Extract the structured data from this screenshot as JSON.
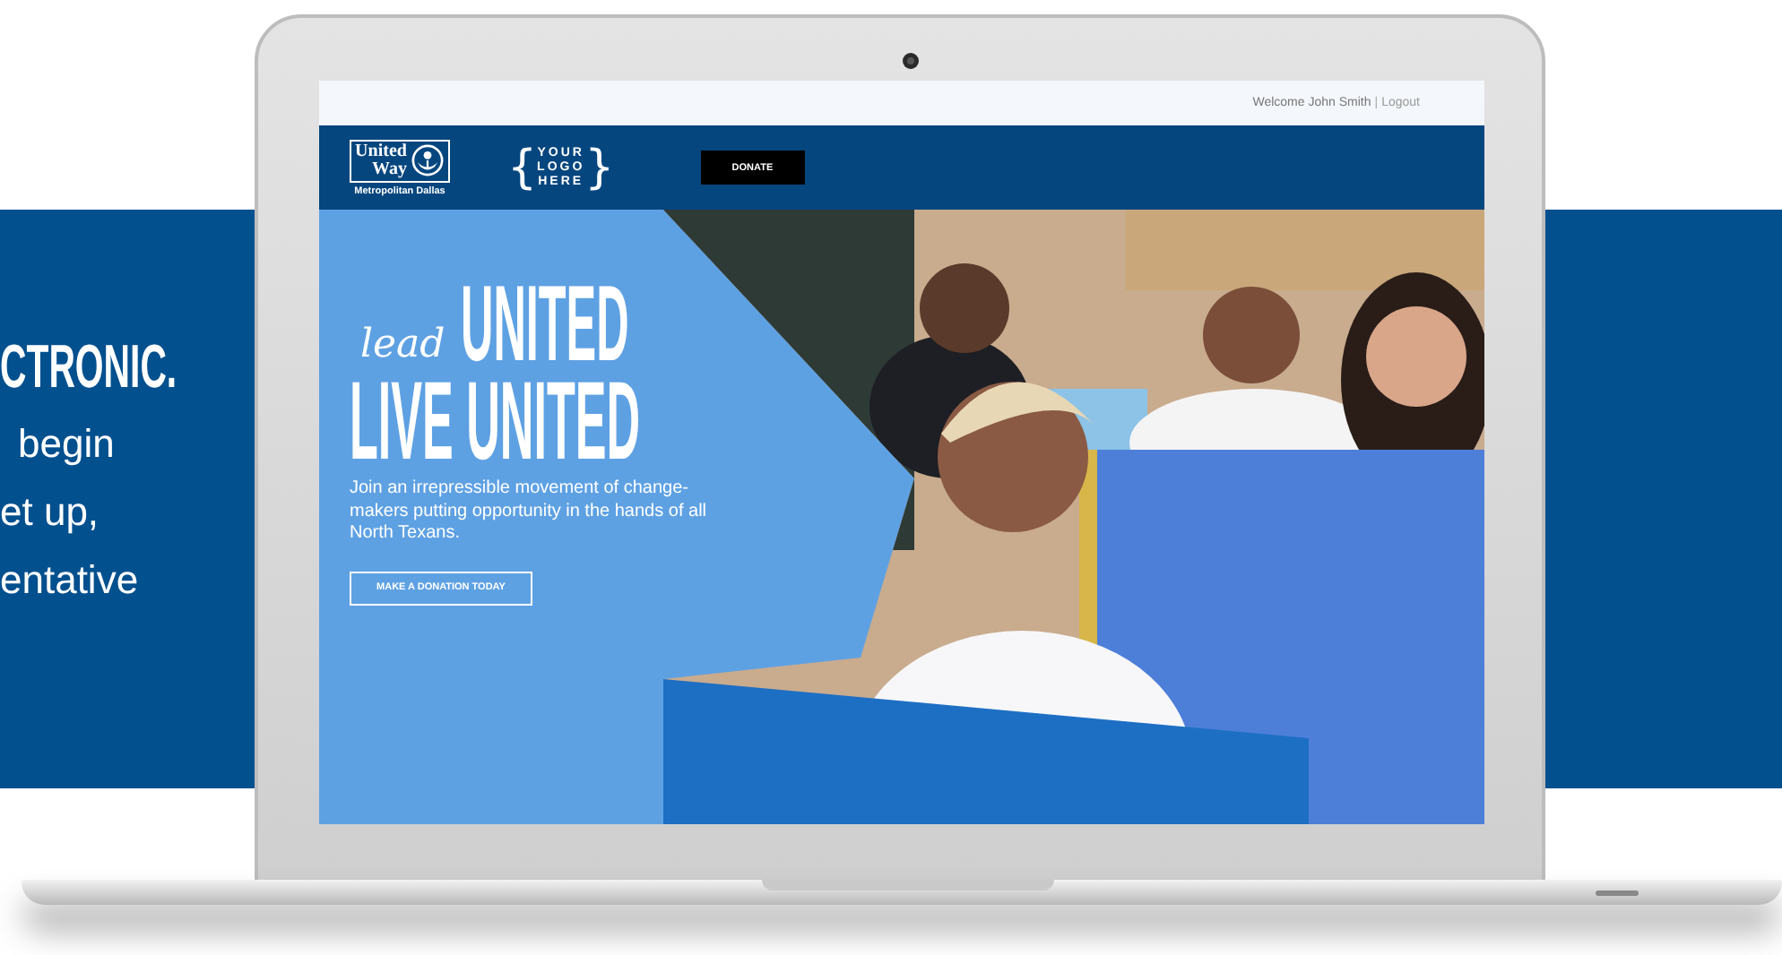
{
  "background_panel": {
    "heading": "CTRONIC.",
    "lines": [
      {
        "text": "begin",
        "indent": true
      },
      {
        "text": "et up,",
        "indent": false
      },
      {
        "text": "entative",
        "indent": false
      }
    ]
  },
  "site": {
    "top_bar": {
      "welcome": "Welcome John Smith",
      "separator": "|",
      "logout": "Logout"
    },
    "header": {
      "logo": {
        "line_1": "United",
        "line_2": "Way",
        "subtitle": "Metropolitan Dallas"
      },
      "placeholder_logo": {
        "brace_left": "{",
        "lines": [
          "YOUR",
          "LOGO",
          "HERE"
        ],
        "brace_right": "}"
      },
      "donate_button": "DONATE"
    },
    "hero": {
      "script_word": "lead",
      "headline_1": "UNITED",
      "headline_2": "LIVE UNITED",
      "text": "Join an irrepressible movement of change-makers putting opportunity in the hands of all North Texans.",
      "cta": "MAKE A DONATION TODAY"
    }
  }
}
